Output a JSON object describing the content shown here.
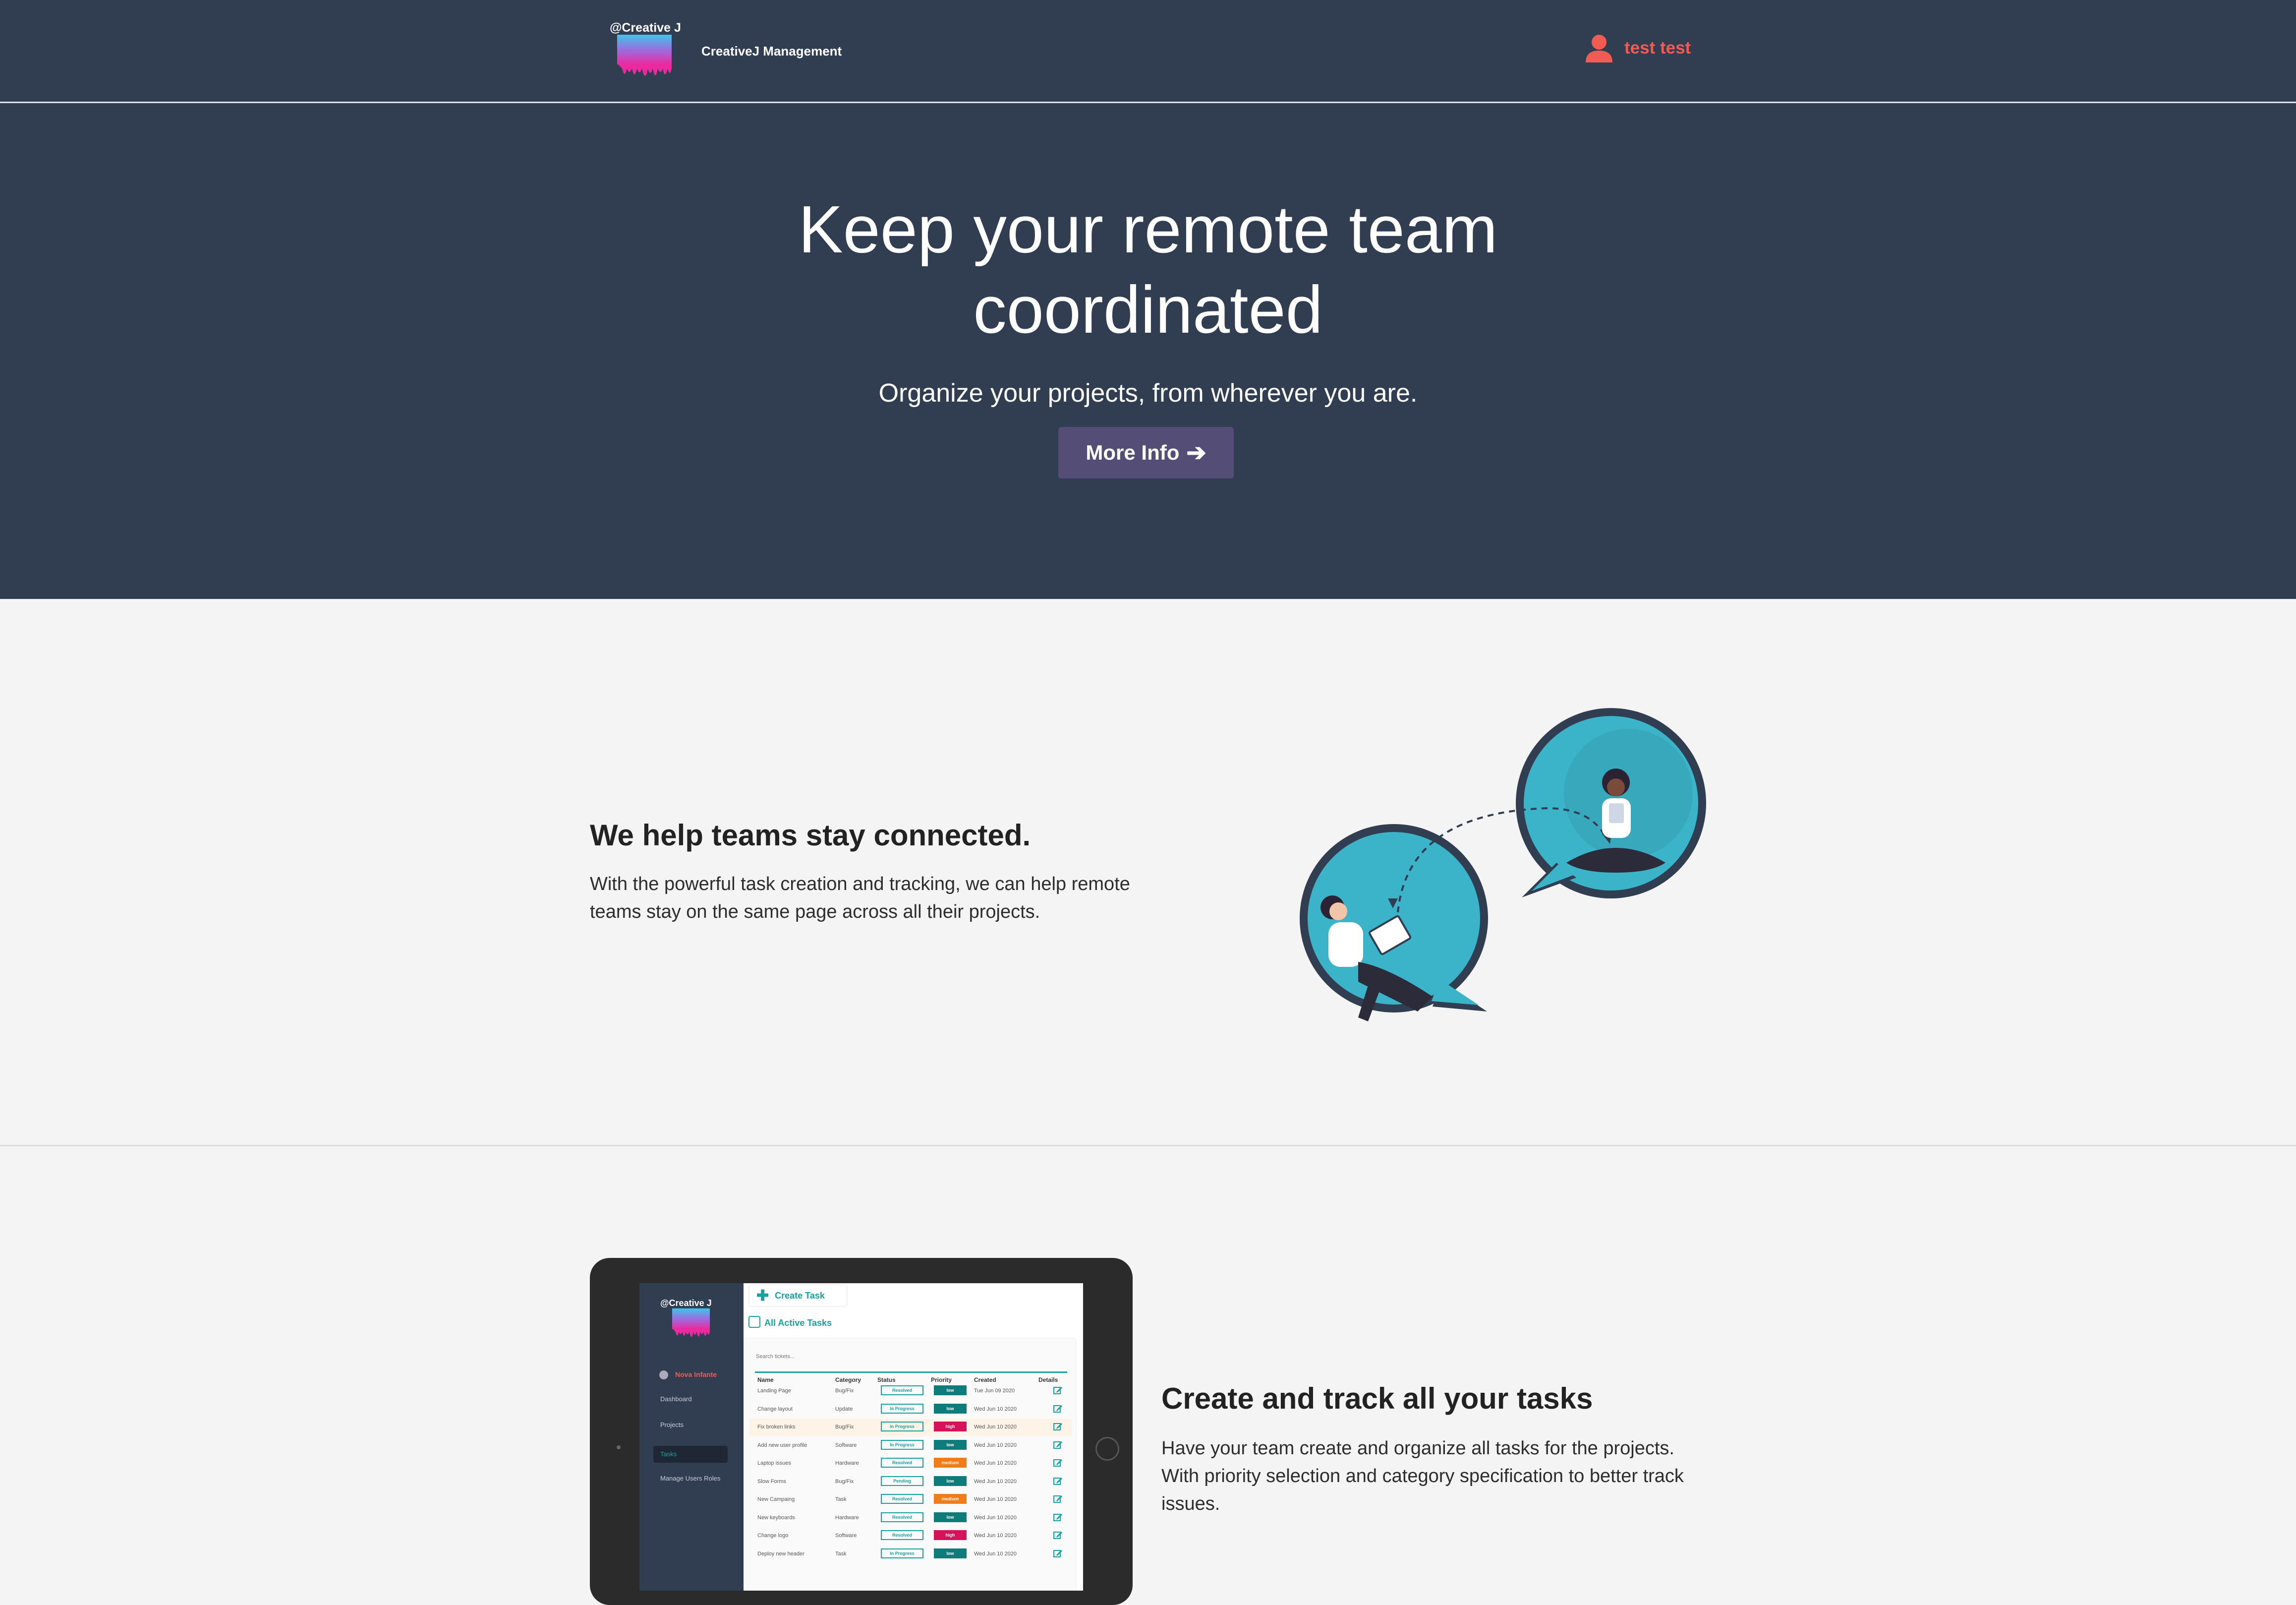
{
  "header": {
    "logo_text": "@Creative J",
    "brand": "CreativeJ Management",
    "user_name": "test test"
  },
  "hero": {
    "title": "Keep your remote team coordinated",
    "subtitle": "Organize your projects, from wherever you are.",
    "button": "More Info"
  },
  "section1": {
    "title": "We help teams stay connected.",
    "text": "With the powerful task creation and tracking, we can help remote teams stay on the same page across all their projects."
  },
  "section2": {
    "title": "Create and track all your tasks",
    "text": "Have your team create and organize all tasks for the projects. With priority selection and category specification to better track issues."
  },
  "tablet": {
    "logo_text": "@Creative J",
    "user": "Nova Infante",
    "nav": [
      "Dashboard",
      "Projects",
      "Tasks",
      "Manage Users Roles"
    ],
    "create_task": "Create Task",
    "all_tasks": "All Active Tasks",
    "search_placeholder": "Search tickets...",
    "columns": [
      "Name",
      "Category",
      "Status",
      "Priority",
      "Created",
      "Details"
    ],
    "rows": [
      {
        "name": "Landing Page",
        "category": "Bug/Fix",
        "status": "Resolved",
        "priority": "low",
        "created": "Tue Jun 09 2020"
      },
      {
        "name": "Change layout",
        "category": "Update",
        "status": "In Progress",
        "priority": "low",
        "created": "Wed Jun 10 2020"
      },
      {
        "name": "Fix broken links",
        "category": "Bug/Fix",
        "status": "In Progress",
        "priority": "high",
        "created": "Wed Jun 10 2020"
      },
      {
        "name": "Add new user profile",
        "category": "Software",
        "status": "In Progress",
        "priority": "low",
        "created": "Wed Jun 10 2020"
      },
      {
        "name": "Laptop issues",
        "category": "Hardware",
        "status": "Resolved",
        "priority": "medium",
        "created": "Wed Jun 10 2020"
      },
      {
        "name": "Slow Forms",
        "category": "Bug/Fix",
        "status": "Pending",
        "priority": "low",
        "created": "Wed Jun 10 2020"
      },
      {
        "name": "New Campaing",
        "category": "Task",
        "status": "Resolved",
        "priority": "medium",
        "created": "Wed Jun 10 2020"
      },
      {
        "name": "New keyboards",
        "category": "Hardware",
        "status": "Resolved",
        "priority": "low",
        "created": "Wed Jun 10 2020"
      },
      {
        "name": "Change logo",
        "category": "Software",
        "status": "Resolved",
        "priority": "high",
        "created": "Wed Jun 10 2020"
      },
      {
        "name": "Deploy new header",
        "category": "Task",
        "status": "In Progress",
        "priority": "low",
        "created": "Wed Jun 10 2020"
      }
    ]
  },
  "colors": {
    "header_bg": "#313d51",
    "accent_red": "#f05b53",
    "button_bg": "#544e77",
    "teal": "#17a2a2",
    "priority_low": "#0f7c7c",
    "priority_medium": "#f07d1a",
    "priority_high": "#d6125b"
  }
}
